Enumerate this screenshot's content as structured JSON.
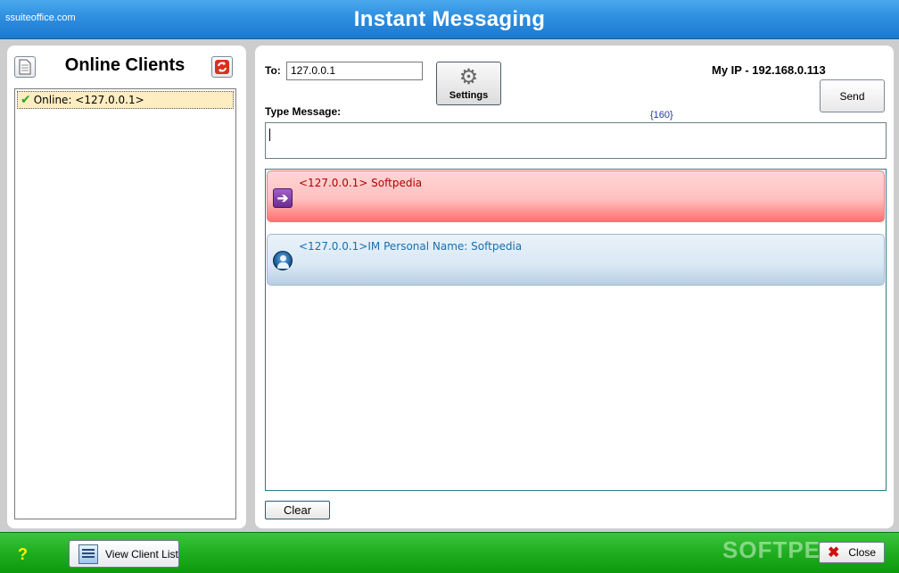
{
  "titlebar": {
    "site": "ssuiteoffice.com",
    "title": "Instant Messaging"
  },
  "left": {
    "title": "Online Clients",
    "doc_icon": "document-icon",
    "refresh_icon": "refresh-icon",
    "clients": [
      {
        "label": "Online: <127.0.0.1>",
        "status_icon": "check-icon"
      }
    ]
  },
  "compose": {
    "to_label": "To:",
    "to_value": "127.0.0.1",
    "settings_label": "Settings",
    "my_ip": "My IP - 192.168.0.113",
    "send_label": "Send",
    "type_label": "Type Message:",
    "char_count": "{160}",
    "message_value": ""
  },
  "chat": {
    "messages": [
      {
        "text": "<127.0.0.1> Softpedia",
        "style": "incoming",
        "icon": "arrow-right-icon",
        "color": "#b00000"
      },
      {
        "text": "<127.0.0.1>IM Personal Name: Softpedia",
        "style": "info",
        "icon": "user-icon",
        "color": "#1a6fb0"
      }
    ],
    "clear_label": "Clear"
  },
  "bottombar": {
    "help_label": "?",
    "view_client_list_label": "View Client List",
    "watermark": "SOFTPEDIA",
    "close_label": "Close"
  },
  "colors": {
    "titlebar": "#2e8fe0",
    "bottombar": "#1fae1f",
    "incoming_bubble": "#ffc0c0",
    "info_bubble": "#d9e8f4"
  }
}
